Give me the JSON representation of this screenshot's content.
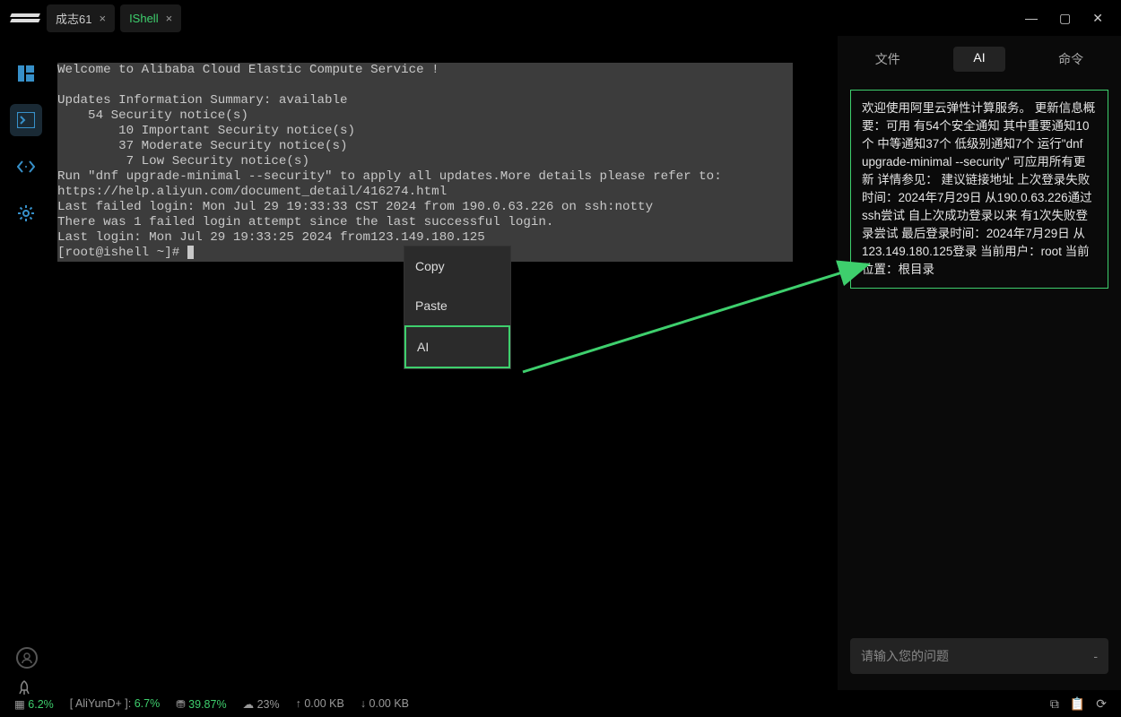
{
  "titlebar": {
    "tabs": [
      {
        "label": "成志61",
        "active": false
      },
      {
        "label": "IShell",
        "active": true
      }
    ]
  },
  "terminal": {
    "lines": [
      "Welcome to Alibaba Cloud Elastic Compute Service !",
      "",
      "Updates Information Summary: available",
      "    54 Security notice(s)",
      "        10 Important Security notice(s)",
      "        37 Moderate Security notice(s)",
      "         7 Low Security notice(s)",
      "Run \"dnf upgrade-minimal --security\" to apply all updates.More details please refer to:",
      "https://help.aliyun.com/document_detail/416274.html",
      "Last failed login: Mon Jul 29 19:33:33 CST 2024 from 190.0.63.226 on ssh:notty",
      "There was 1 failed login attempt since the last successful login.",
      "Last login: Mon Jul 29 19:33:25 2024 from123.149.180.125"
    ],
    "prompt": "[root@ishell ~]# "
  },
  "context_menu": {
    "copy": "Copy",
    "paste": "Paste",
    "ai": "AI"
  },
  "right_panel": {
    "tabs": {
      "file": "文件",
      "ai": "AI",
      "cmd": "命令"
    },
    "ai_text": "欢迎使用阿里云弹性计算服务。 更新信息概要：可用 有54个安全通知 其中重要通知10个 中等通知37个 低级别通知7个 运行\"dnf upgrade-minimal --security\" 可应用所有更新 详情参见： 建议链接地址 上次登录失败时间：2024年7月29日 从190.0.63.226通过ssh尝试 自上次成功登录以来 有1次失败登录尝试 最后登录时间：2024年7月29日 从123.149.180.125登录 当前用户：root 当前位置：根目录",
    "input_placeholder": "请输入您的问题",
    "input_dash": "-"
  },
  "status": {
    "chip_pct": "6.2%",
    "aliyun_label": "[ AliYunD+ ]: ",
    "aliyun_pct": "6.7%",
    "disk_pct": "39.87%",
    "cloud_pct": "23%",
    "up": "0.00 KB",
    "down": "0.00 KB"
  }
}
